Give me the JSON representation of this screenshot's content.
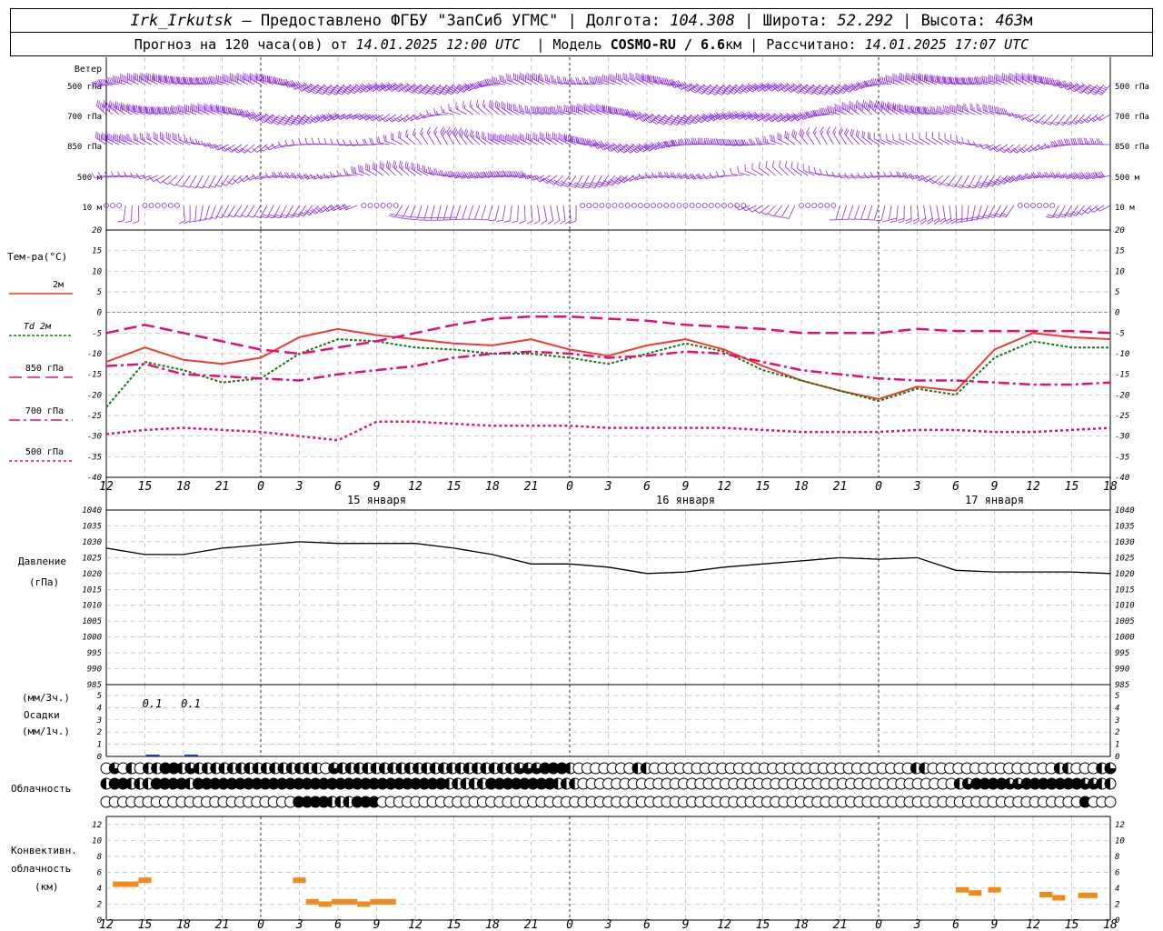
{
  "header": {
    "station": "Irk_Irkutsk",
    "provider": "— Предоставлено ФГБУ \"ЗапСиб УГМС\"",
    "lon_label": "Долгота:",
    "lon_value": "104.308",
    "lat_label": "Широта:",
    "lat_value": "52.292",
    "alt_label": "Высота:",
    "alt_value": "463",
    "alt_unit": "м",
    "forecast_label": "Прогноз на 120 часа(ов) от",
    "forecast_start": "14.01.2025 12:00 UTC",
    "model_label": "Модель",
    "model_name": "COSMO-RU / 6.6",
    "model_unit": "км",
    "computed_label": "Рассчитано:",
    "computed_time": "14.01.2025 17:07 UTC"
  },
  "colors": {
    "wind": "#8a2be2",
    "t2m": "#ef3b2c",
    "td2m": "#117a11",
    "t850": "#e0107a",
    "t700": "#e0107a",
    "t500": "#e0107a",
    "zero_line": "#2b4cd9",
    "conv_cloud": "#f08a1a",
    "precip": "#1f3fa8"
  },
  "chart_data": [
    {
      "type": "barbs",
      "title": "Ветер",
      "levels": [
        "500 гПа",
        "700 гПа",
        "850 гПа",
        "500 м",
        "10 м"
      ]
    },
    {
      "type": "line",
      "title": "Тем-ра(°C)",
      "ylim": [
        -40,
        20
      ],
      "yticks": [
        20,
        15,
        10,
        5,
        0,
        -5,
        -10,
        -15,
        -20,
        -25,
        -30,
        -35,
        -40
      ],
      "x": [
        0,
        3,
        6,
        9,
        12,
        15,
        18,
        21,
        24,
        27,
        30,
        33,
        36,
        39,
        42,
        45,
        48,
        51,
        54,
        57,
        60,
        63,
        66,
        69,
        72,
        75,
        78
      ],
      "series": [
        {
          "name": "2м",
          "values": [
            -12,
            -8.5,
            -11.5,
            -12.5,
            -11,
            -6,
            -4,
            -5.5,
            -6.5,
            -7.5,
            -8,
            -6.5,
            -9,
            -10.5,
            -8,
            -6.5,
            -9,
            -13,
            -16.5,
            -19,
            -21,
            -18,
            -19,
            -9,
            -5,
            -6,
            -6.5
          ]
        },
        {
          "name": "Td 2м",
          "values": [
            -23,
            -12,
            -14,
            -17,
            -16,
            -10,
            -6.5,
            -7,
            -8.5,
            -9,
            -10,
            -10,
            -11,
            -12.5,
            -10,
            -7.5,
            -9.5,
            -14,
            -16.5,
            -19,
            -21.5,
            -18.5,
            -20,
            -11,
            -7,
            -8.5,
            -8.5
          ]
        },
        {
          "name": "850 гПа",
          "values": [
            -5,
            -3,
            -5,
            -7,
            -9,
            -10,
            -8.5,
            -7,
            -5,
            -3,
            -1.5,
            -1,
            -1,
            -1.5,
            -2,
            -3,
            -3.5,
            -4,
            -5,
            -5,
            -5,
            -4,
            -4.5,
            -4.5,
            -4.5,
            -4.5,
            -5
          ]
        },
        {
          "name": "700 гПа",
          "values": [
            -13,
            -12.5,
            -15,
            -15.5,
            -16,
            -16.5,
            -15,
            -14,
            -13,
            -11,
            -10,
            -9.5,
            -10,
            -11,
            -10.5,
            -9.5,
            -10,
            -12,
            -14,
            -15,
            -16,
            -16.5,
            -16.5,
            -17,
            -17.5,
            -17.5,
            -17
          ]
        },
        {
          "name": "500 гПа",
          "values": [
            -29.5,
            -28.5,
            -28,
            -28.5,
            -29,
            -30,
            -31,
            -26.5,
            -26.5,
            -27,
            -27.5,
            -27.5,
            -27.5,
            -28,
            -28,
            -28,
            -28,
            -28.5,
            -29,
            -29,
            -29,
            -28.5,
            -28.5,
            -29,
            -29,
            -28.5,
            -28
          ]
        }
      ]
    },
    {
      "type": "line",
      "title": "Давление",
      "ylabel": "(гПа)",
      "ylim": [
        985,
        1040
      ],
      "yticks": [
        1040,
        1035,
        1030,
        1025,
        1020,
        1015,
        1010,
        1005,
        1000,
        995,
        990,
        985
      ],
      "x": [
        0,
        3,
        6,
        9,
        12,
        15,
        18,
        21,
        24,
        27,
        30,
        33,
        36,
        39,
        42,
        45,
        48,
        51,
        54,
        57,
        60,
        63,
        66,
        69,
        72,
        75,
        78
      ],
      "series": [
        {
          "name": "Давление",
          "values": [
            1028,
            1026,
            1026,
            1028,
            1029,
            1030,
            1029.5,
            1029.5,
            1029.5,
            1028,
            1026,
            1023,
            1023,
            1022,
            1020,
            1020.5,
            1022,
            1023,
            1024,
            1025,
            1024.5,
            1025,
            1021,
            1020.5,
            1020.5,
            1020.5,
            1020
          ]
        }
      ]
    },
    {
      "type": "bar",
      "title": "Осадки",
      "ylabel_top": "(мм/3ч.)",
      "ylabel_bottom": "(мм/1ч.)",
      "ylim": [
        0,
        5
      ],
      "yticks": [
        5,
        4,
        3,
        2,
        1,
        0
      ],
      "annotations": [
        {
          "x": 3,
          "text": "0.1"
        },
        {
          "x": 6,
          "text": "0.1"
        }
      ]
    },
    {
      "type": "cloud-symbols",
      "title": "Облачность",
      "rows": [
        [
          1,
          3,
          1,
          2,
          1,
          2,
          2,
          4,
          4,
          2,
          3,
          2,
          2,
          2,
          2,
          2,
          2,
          2,
          2,
          2,
          2,
          2,
          2,
          2,
          2,
          2,
          1,
          3,
          2,
          2,
          2,
          2,
          2,
          2,
          2,
          2,
          2,
          2,
          2,
          2,
          2,
          2,
          2,
          2,
          2,
          2,
          2,
          2,
          2,
          3,
          3,
          3,
          4,
          4,
          4,
          2,
          1,
          1,
          1,
          1,
          1,
          1,
          1,
          2,
          2,
          1,
          1,
          1,
          1,
          1,
          1,
          1,
          1,
          1,
          1,
          1,
          1,
          1,
          1,
          1,
          1,
          1,
          1,
          1,
          1,
          1,
          1,
          1,
          1,
          1,
          1,
          1,
          1,
          1,
          1,
          1,
          2,
          2,
          1,
          1,
          1,
          1,
          1,
          1,
          1,
          1,
          1,
          1,
          1,
          1,
          1,
          1,
          1,
          2,
          2,
          1,
          1,
          1,
          2,
          3
        ],
        [
          2,
          4,
          4,
          2,
          2,
          2,
          4,
          4,
          4,
          4,
          2,
          4,
          4,
          4,
          4,
          4,
          4,
          4,
          4,
          4,
          4,
          4,
          4,
          4,
          4,
          4,
          4,
          4,
          4,
          4,
          4,
          4,
          4,
          4,
          4,
          4,
          4,
          4,
          4,
          4,
          4,
          2,
          2,
          2,
          2,
          2,
          4,
          4,
          4,
          4,
          4,
          4,
          4,
          4,
          2,
          2,
          2,
          1,
          1,
          1,
          1,
          1,
          1,
          1,
          1,
          1,
          1,
          1,
          1,
          1,
          1,
          1,
          1,
          1,
          1,
          1,
          1,
          1,
          1,
          1,
          1,
          1,
          1,
          1,
          1,
          1,
          1,
          1,
          1,
          1,
          1,
          1,
          1,
          1,
          1,
          1,
          1,
          1,
          1,
          1,
          1,
          1,
          2,
          3,
          4,
          4,
          4,
          4,
          3,
          3,
          4,
          4,
          4,
          4,
          4,
          4,
          4,
          3,
          3,
          2,
          2
        ],
        [
          1,
          1,
          1,
          1,
          1,
          1,
          1,
          1,
          1,
          1,
          1,
          1,
          1,
          1,
          1,
          1,
          1,
          1,
          1,
          1,
          1,
          1,
          1,
          4,
          4,
          4,
          4,
          2,
          2,
          2,
          4,
          4,
          4,
          1,
          1,
          1,
          1,
          1,
          1,
          1,
          1,
          1,
          1,
          1,
          1,
          1,
          1,
          1,
          1,
          1,
          1,
          1,
          1,
          1,
          1,
          1,
          1,
          1,
          1,
          1,
          1,
          1,
          1,
          1,
          1,
          1,
          1,
          1,
          1,
          1,
          1,
          1,
          1,
          1,
          1,
          1,
          1,
          1,
          1,
          1,
          1,
          1,
          1,
          1,
          1,
          1,
          1,
          1,
          1,
          1,
          1,
          1,
          1,
          1,
          1,
          1,
          1,
          1,
          1,
          1,
          1,
          1,
          1,
          1,
          1,
          1,
          1,
          1,
          1,
          1,
          1,
          1,
          1,
          1,
          1,
          1,
          1,
          4,
          1,
          1,
          1
        ]
      ]
    },
    {
      "type": "bar",
      "title": "Конвективн. облачность",
      "ylabel": "(км)",
      "ylim": [
        0,
        13
      ],
      "yticks": [
        12,
        10,
        8,
        6,
        4,
        2,
        0
      ],
      "segments": [
        {
          "x0": 0.5,
          "x1": 2.5,
          "y": 4.5
        },
        {
          "x0": 2.5,
          "x1": 3.5,
          "y": 5
        },
        {
          "x0": 14.5,
          "x1": 15.5,
          "y": 5
        },
        {
          "x0": 15.5,
          "x1": 16.5,
          "y": 2.3
        },
        {
          "x0": 16.5,
          "x1": 17.5,
          "y": 2
        },
        {
          "x0": 17.5,
          "x1": 19.5,
          "y": 2.3
        },
        {
          "x0": 19.5,
          "x1": 20.5,
          "y": 2
        },
        {
          "x0": 20.5,
          "x1": 22.5,
          "y": 2.3
        },
        {
          "x0": 66,
          "x1": 67,
          "y": 3.8
        },
        {
          "x0": 67,
          "x1": 68,
          "y": 3.4
        },
        {
          "x0": 68.5,
          "x1": 69.5,
          "y": 3.8
        },
        {
          "x0": 72.5,
          "x1": 73.5,
          "y": 3.2
        },
        {
          "x0": 73.5,
          "x1": 74.5,
          "y": 2.8
        },
        {
          "x0": 75.5,
          "x1": 77,
          "y": 3.1
        }
      ]
    }
  ],
  "time_axis": {
    "tick_labels": [
      "12",
      "15",
      "18",
      "21",
      "0",
      "3",
      "6",
      "9",
      "12",
      "15",
      "18",
      "21",
      "0",
      "3",
      "6",
      "9",
      "12",
      "15",
      "18",
      "21",
      "0",
      "3",
      "6",
      "9",
      "12",
      "15",
      "18"
    ],
    "day_labels": [
      {
        "x": 21,
        "text": "15 января"
      },
      {
        "x": 45,
        "text": "16 января"
      },
      {
        "x": 69,
        "text": "17 января"
      }
    ]
  }
}
